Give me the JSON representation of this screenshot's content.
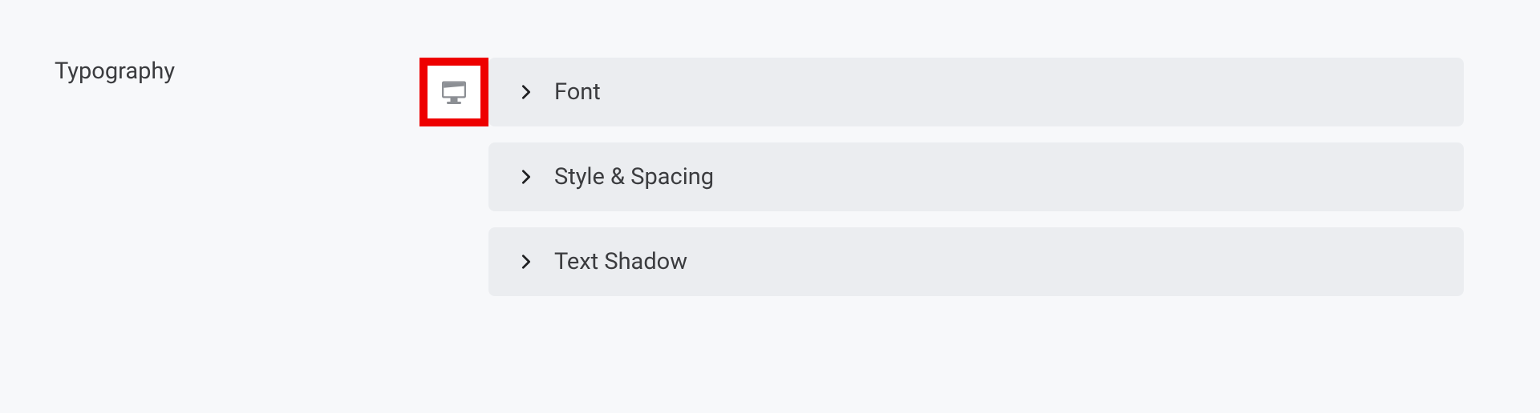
{
  "section": {
    "title": "Typography"
  },
  "panels": [
    {
      "label": "Font"
    },
    {
      "label": "Style & Spacing"
    },
    {
      "label": "Text Shadow"
    }
  ]
}
